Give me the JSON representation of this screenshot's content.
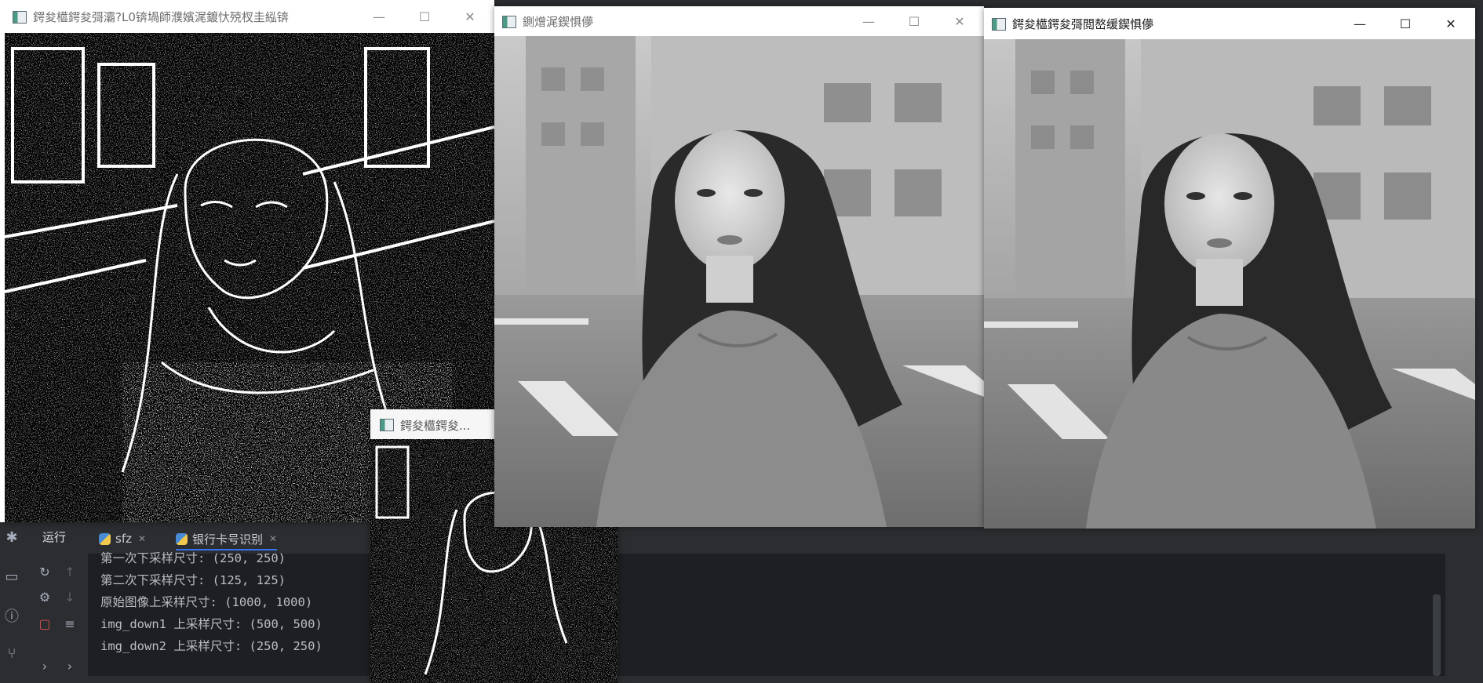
{
  "windows": {
    "edge": {
      "title": "鍔夋櫙鍔夋彁灞?L0锛堝師濮嬪浘鍍忕殑杈圭紭锛",
      "min_icon": "minimize-icon",
      "max_icon": "maximize-icon",
      "close_icon": "close-icon"
    },
    "original": {
      "title": "鍘熷浘鍥惧儚"
    },
    "result": {
      "title": "鍔夋櫙鍔夋彁閲嶅缓鍥惧儚"
    },
    "small": {
      "title": "鍔夋櫙鍔夋..."
    }
  },
  "ide": {
    "run_label": "运行",
    "tabs": [
      {
        "label": "sfz",
        "icon": "python-icon"
      },
      {
        "label": "银行卡号识别",
        "icon": "python-icon"
      }
    ],
    "console_lines": [
      "第一次下采样尺寸: (250, 250)",
      "第二次下采样尺寸: (125, 125)",
      "原始图像上采样尺寸: (1000, 1000)",
      "img_down1 上采样尺寸: (500, 500)",
      "img_down2 上采样尺寸: (250, 250)"
    ],
    "icons": [
      "bug-icon",
      "terminal-icon",
      "problems-icon",
      "git-icon",
      "rerun-icon",
      "settings-icon",
      "stop-icon",
      "up-arrow-icon",
      "down-arrow-icon",
      "soft-wrap-icon",
      "chevron-right-icon"
    ]
  },
  "colors": {
    "console_bg": "#1e1f22",
    "ide_bg": "#2b2d30",
    "accent": "#3574f0"
  }
}
